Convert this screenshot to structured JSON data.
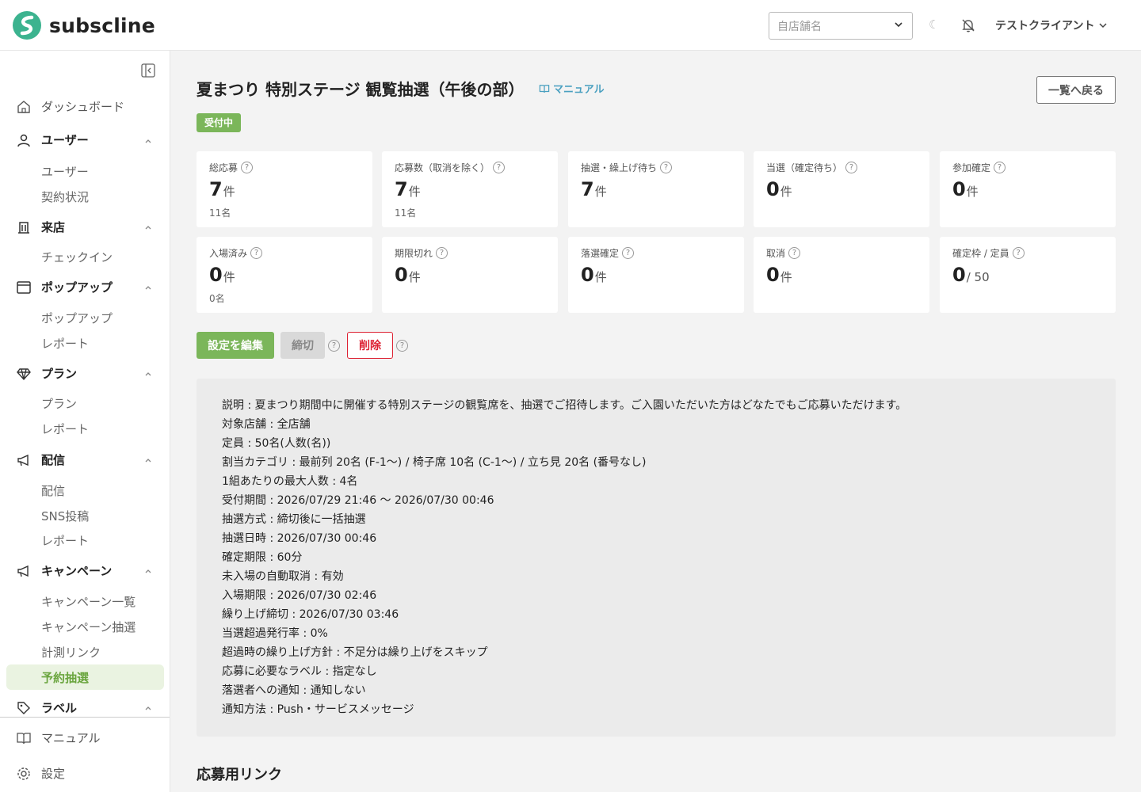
{
  "header": {
    "logo_text": "subscline",
    "store_select_placeholder": "自店舗名",
    "account_name": "テストクライアント"
  },
  "sidebar": {
    "items": [
      {
        "label": "ダッシュボード"
      },
      {
        "label": "ユーザー",
        "children": [
          "ユーザー",
          "契約状況"
        ]
      },
      {
        "label": "来店",
        "children": [
          "チェックイン"
        ]
      },
      {
        "label": "ポップアップ",
        "children": [
          "ポップアップ",
          "レポート"
        ]
      },
      {
        "label": "プラン",
        "children": [
          "プラン",
          "レポート"
        ]
      },
      {
        "label": "配信",
        "children": [
          "配信",
          "SNS投稿",
          "レポート"
        ]
      },
      {
        "label": "キャンペーン",
        "children": [
          "キャンペーン一覧",
          "キャンペーン抽選",
          "計測リンク",
          "予約抽選"
        ]
      },
      {
        "label": "ラベル"
      }
    ],
    "active_item": "予約抽選",
    "bottom": {
      "manual": "マニュアル",
      "settings": "設定"
    }
  },
  "page": {
    "title": "夏まつり 特別ステージ 観覧抽選（午後の部）",
    "manual_link": "マニュアル",
    "back_button": "一覧へ戻る",
    "status_badge": "受付中"
  },
  "stats": [
    {
      "label": "総応募",
      "value": "7",
      "unit": "件",
      "sub": "11名"
    },
    {
      "label": "応募数（取消を除く）",
      "value": "7",
      "unit": "件",
      "sub": "11名"
    },
    {
      "label": "抽選・繰上げ待ち",
      "value": "7",
      "unit": "件",
      "sub": ""
    },
    {
      "label": "当選（確定待ち）",
      "value": "0",
      "unit": "件",
      "sub": ""
    },
    {
      "label": "参加確定",
      "value": "0",
      "unit": "件",
      "sub": ""
    },
    {
      "label": "入場済み",
      "value": "0",
      "unit": "件",
      "sub": "0名"
    },
    {
      "label": "期限切れ",
      "value": "0",
      "unit": "件",
      "sub": ""
    },
    {
      "label": "落選確定",
      "value": "0",
      "unit": "件",
      "sub": ""
    },
    {
      "label": "取消",
      "value": "0",
      "unit": "件",
      "sub": ""
    },
    {
      "label": "確定枠 / 定員",
      "value": "0",
      "unit": "/ 50",
      "sub": ""
    }
  ],
  "actions": {
    "edit": "設定を編集",
    "close": "締切",
    "delete": "削除"
  },
  "description_lines": [
    "説明 : 夏まつり期間中に開催する特別ステージの観覧席を、抽選でご招待します。ご入園いただいた方はどなたでもご応募いただけます。",
    "対象店舗 : 全店舗",
    "定員 : 50名(人数(名))",
    "割当カテゴリ : 最前列 20名 (F-1〜) / 椅子席 10名 (C-1〜) / 立ち見 20名 (番号なし)",
    "1組あたりの最大人数 : 4名",
    "受付期間 : 2026/07/29 21:46 〜 2026/07/30 00:46",
    "抽選方式 : 締切後に一括抽選",
    "抽選日時 : 2026/07/30 00:46",
    "確定期限 : 60分",
    "未入場の自動取消 : 有効",
    "入場期限 : 2026/07/30 02:46",
    "繰り上げ締切 : 2026/07/30 03:46",
    "当選超過発行率 : 0%",
    "超過時の繰り上げ方針 : 不足分は繰り上げをスキップ",
    "応募に必要なラベル : 指定なし",
    "落選者への通知 : 通知しない",
    "通知方法 : Push・サービスメッセージ"
  ],
  "link_section": {
    "title": "応募用リンク"
  },
  "colors": {
    "accent_green": "#7bb65a",
    "danger_red": "#dd2233",
    "link_blue": "#4aa0c0"
  }
}
